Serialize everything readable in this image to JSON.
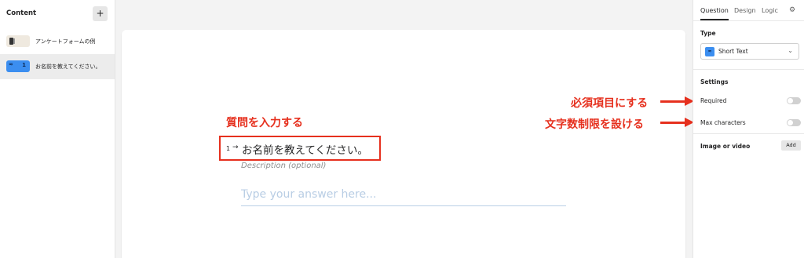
{
  "sidebar": {
    "title": "Content",
    "add_label": "+",
    "items": [
      {
        "label": "アンケートフォームの例",
        "type_icon": "welcome-screen-icon"
      },
      {
        "label": "お名前を教えてください。",
        "number": "1",
        "type_icon": "short-text-icon"
      }
    ]
  },
  "question": {
    "number": "1",
    "arrow": "→",
    "title": "お名前を教えてください。",
    "description_placeholder": "Description (optional)",
    "answer_placeholder": "Type your answer here..."
  },
  "annotations": {
    "question": "質問を入力する",
    "required": "必須項目にする",
    "max_chars": "文字数制限を設ける",
    "color": "#e6301e"
  },
  "panel": {
    "tabs": [
      "Question",
      "Design",
      "Logic"
    ],
    "active_tab": "Question",
    "settings_icon": "gear-icon",
    "type_label": "Type",
    "type_value": "Short Text",
    "type_icon_text": "≂",
    "settings_label": "Settings",
    "required_label": "Required",
    "required_on": false,
    "max_chars_label": "Max characters",
    "max_chars_on": false,
    "image_label": "Image or video",
    "add_label": "Add"
  },
  "colors": {
    "accent_blue": "#3b8ef0",
    "annotation_red": "#e6301e",
    "placeholder_blue": "#b8cde4"
  }
}
